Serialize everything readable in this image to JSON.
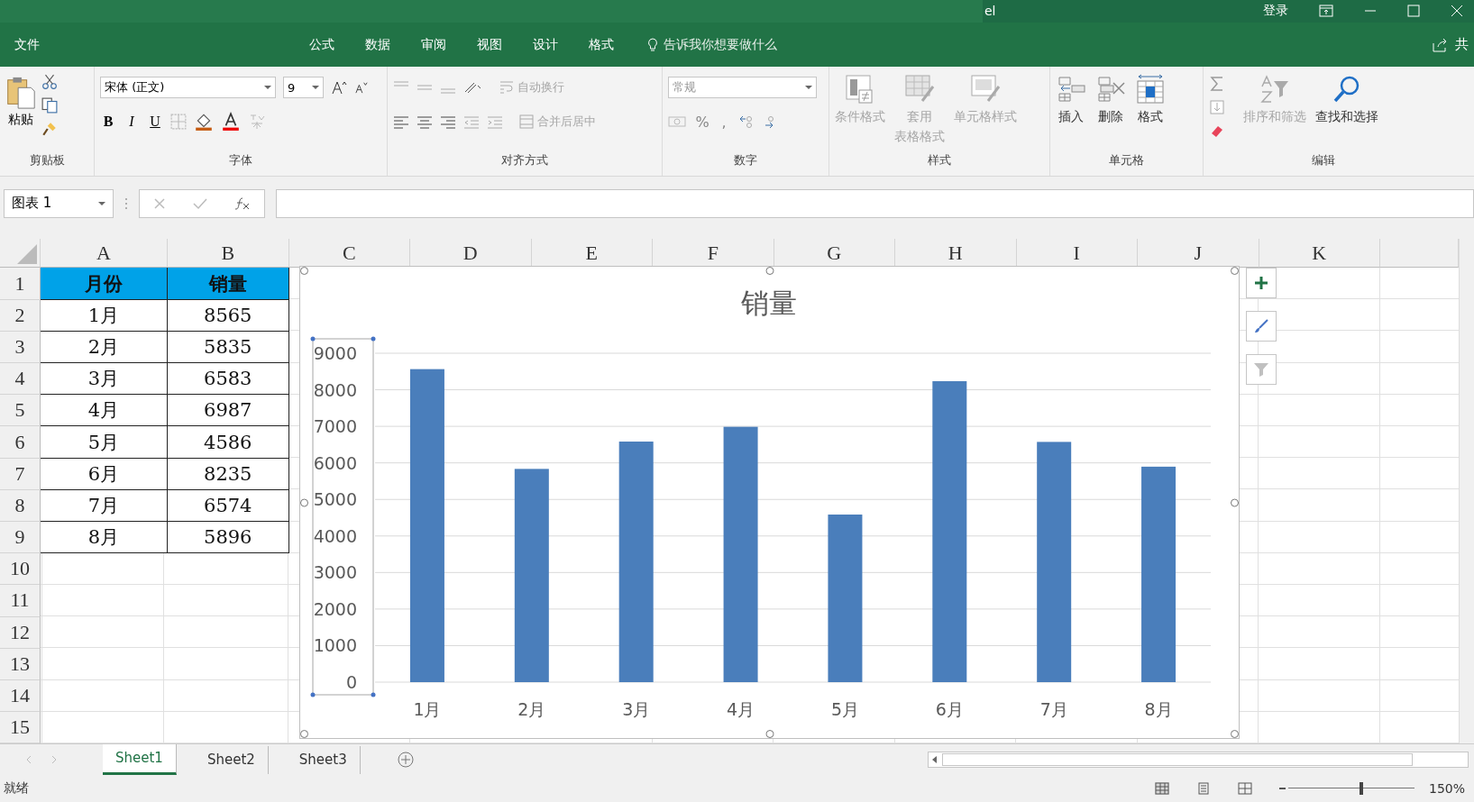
{
  "window": {
    "title": "el",
    "sign_in": "登录"
  },
  "ribbon_tabs": [
    {
      "label": "文件"
    },
    {
      "label": "公式"
    },
    {
      "label": "数据"
    },
    {
      "label": "审阅"
    },
    {
      "label": "视图"
    },
    {
      "label": "设计"
    },
    {
      "label": "格式"
    }
  ],
  "tell_me": "告诉我你想要做什么",
  "share": "共",
  "ribbon": {
    "clipboard": {
      "paste": "粘贴",
      "label": "剪贴板"
    },
    "font": {
      "family": "宋体 (正文)",
      "size": "9",
      "bold": "B",
      "italic": "I",
      "underline": "U",
      "label": "字体"
    },
    "alignment": {
      "wrap": "自动换行",
      "merge": "合并后居中",
      "label": "对齐方式"
    },
    "number": {
      "format": "常规",
      "percent": "%",
      "comma": ",",
      "label": "数字"
    },
    "groups": [
      {
        "label": "样式",
        "buttons": [
          {
            "label": "条件格式",
            "kind": "cond",
            "disabled": true
          },
          {
            "label": [
              "套用",
              "表格格式"
            ],
            "kind": "table",
            "disabled": true
          },
          {
            "label": "单元格样式",
            "kind": "cellstyle",
            "disabled": true
          }
        ]
      },
      {
        "label": "单元格",
        "buttons": [
          {
            "label": "插入",
            "kind": "insert",
            "disabled": false
          },
          {
            "label": "删除",
            "kind": "delete",
            "disabled": false
          },
          {
            "label": "格式",
            "kind": "format",
            "disabled": false
          }
        ]
      },
      {
        "label": "编辑",
        "buttons": [
          {
            "label": "排序和筛选",
            "kind": "sort",
            "disabled": true
          },
          {
            "label": "查找和选择",
            "kind": "find",
            "disabled": false
          }
        ]
      }
    ]
  },
  "name_box": "图表 1",
  "columns": [
    "A",
    "B",
    "C",
    "D",
    "E",
    "F",
    "G",
    "H",
    "I",
    "J",
    "K"
  ],
  "rows": [
    {
      "number": "1",
      "cells": [
        "月份",
        "销量"
      ]
    },
    {
      "number": "2",
      "cells": [
        "1月",
        "8565"
      ]
    },
    {
      "number": "3",
      "cells": [
        "2月",
        "5835"
      ]
    },
    {
      "number": "4",
      "cells": [
        "3月",
        "6583"
      ]
    },
    {
      "number": "5",
      "cells": [
        "4月",
        "6987"
      ]
    },
    {
      "number": "6",
      "cells": [
        "5月",
        "4586"
      ]
    },
    {
      "number": "7",
      "cells": [
        "6月",
        "8235"
      ]
    },
    {
      "number": "8",
      "cells": [
        "7月",
        "6574"
      ]
    },
    {
      "number": "9",
      "cells": [
        "8月",
        "5896"
      ]
    },
    {
      "number": "10",
      "cells": []
    },
    {
      "number": "11",
      "cells": []
    },
    {
      "number": "12",
      "cells": []
    },
    {
      "number": "13",
      "cells": []
    },
    {
      "number": "14",
      "cells": []
    },
    {
      "number": "15",
      "cells": []
    }
  ],
  "chart_data": {
    "type": "bar",
    "title": "销量",
    "categories": [
      "1月",
      "2月",
      "3月",
      "4月",
      "5月",
      "6月",
      "7月",
      "8月"
    ],
    "values": [
      8565,
      5835,
      6583,
      6987,
      4586,
      8235,
      6574,
      5896
    ],
    "ylim": [
      0,
      9000
    ],
    "grid": true,
    "yticks": [
      0,
      1000,
      2000,
      3000,
      4000,
      5000,
      6000,
      7000,
      8000,
      9000
    ]
  },
  "sheet_tabs": [
    {
      "label": "Sheet1",
      "selected": true
    },
    {
      "label": "Sheet2",
      "selected": false
    },
    {
      "label": "Sheet3",
      "selected": false
    }
  ],
  "status": "就绪",
  "zoom": {
    "label": "150%",
    "level": 0.58
  }
}
